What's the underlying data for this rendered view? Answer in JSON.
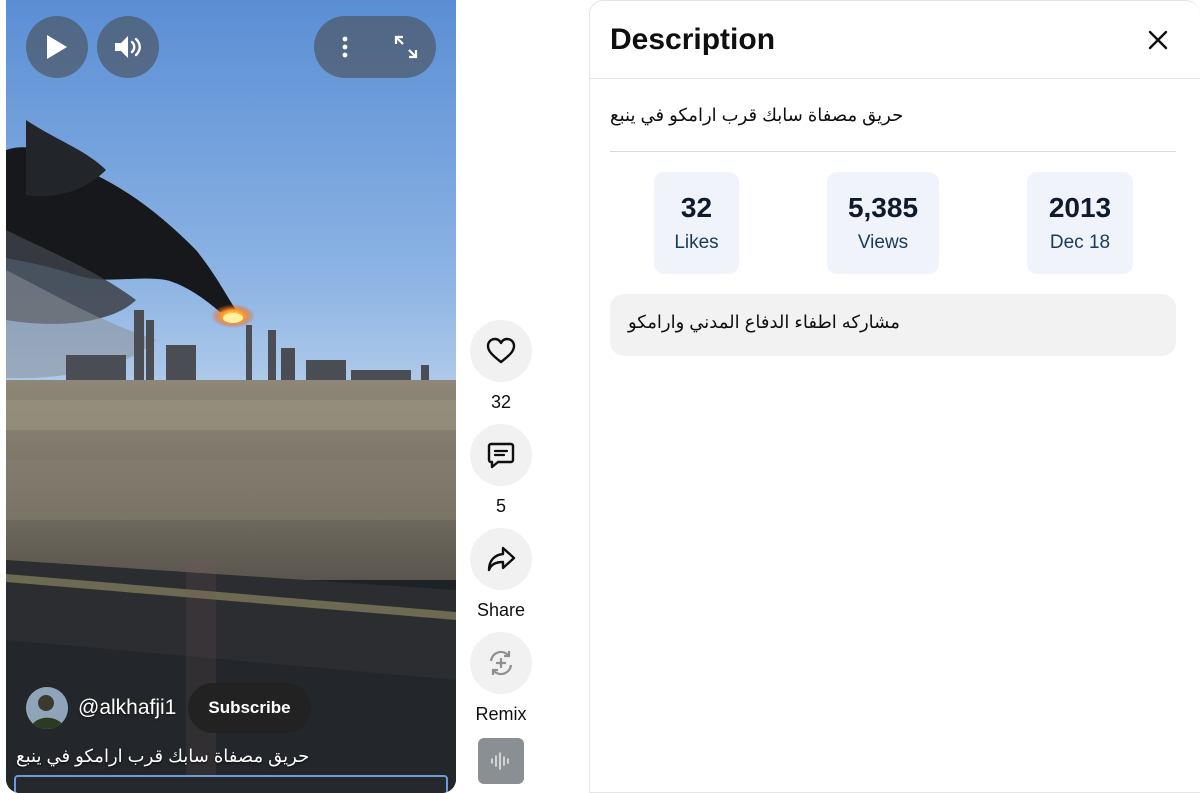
{
  "video": {
    "channel_handle": "@alkhafji1",
    "subscribe_label": "Subscribe",
    "title": "حريق مصفاة سابك قرب ارامكو في ينبع"
  },
  "actions": {
    "like_count": "32",
    "comment_count": "5",
    "share_label": "Share",
    "remix_label": "Remix"
  },
  "description": {
    "heading": "Description",
    "title": "حريق مصفاة سابك قرب ارامكو في ينبع",
    "stats": [
      {
        "value": "32",
        "label": "Likes"
      },
      {
        "value": "5,385",
        "label": "Views"
      },
      {
        "value": "2013",
        "label": "Dec 18"
      }
    ],
    "body": "مشاركه اطفاء الدفاع المدني وارامكو"
  },
  "icons": {
    "play": "play-icon",
    "volume": "volume-icon",
    "more": "more-vert-icon",
    "fullscreen": "fullscreen-icon",
    "like": "heart-icon",
    "comment": "comment-icon",
    "share": "share-icon",
    "remix": "remix-icon",
    "sound": "sound-wave-icon",
    "close": "close-icon"
  }
}
